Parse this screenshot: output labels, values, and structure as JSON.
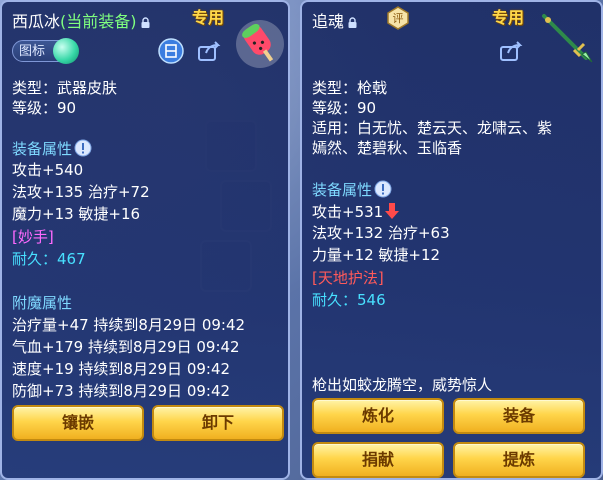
{
  "left": {
    "name": "西瓜冰",
    "equipped_note": "(当前装备)",
    "exclusive": "专用",
    "tag_label": "图标",
    "type": "类型：武器皮肤",
    "level": "等级：90",
    "attr_title": "装备属性",
    "attr_lines": [
      "攻击+540",
      "法攻+135 治疗+72",
      "魔力+13 敏捷+16"
    ],
    "special": "[妙手]",
    "durability_label": "耐久：",
    "durability_value": "467",
    "enchant_title": "附魔属性",
    "enchant_lines": [
      "治疗量+47 持续到8月29日 09:42",
      "气血+179 持续到8月29日 09:42",
      "速度+19 持续到8月29日 09:42",
      "防御+73 持续到8月29日 09:42"
    ],
    "buttons": [
      "镶嵌",
      "卸下"
    ]
  },
  "right": {
    "name": "追魂",
    "exclusive": "专用",
    "badge": "评",
    "type": "类型：枪戟",
    "level": "等级：90",
    "suit_line1": "适用：白无忧、楚云天、龙啸云、紫",
    "suit_line2": "嫣然、楚碧秋、玉临香",
    "attr_title": "装备属性",
    "attr_lines": [
      "攻击+531",
      "法攻+132 治疗+63",
      "力量+12 敏捷+12"
    ],
    "special": "[天地护法]",
    "durability_label": "耐久：",
    "durability_value": "546",
    "description": "枪出如蛟龙腾空，威势惊人",
    "buttons": [
      "炼化",
      "装备",
      "捐献",
      "提炼"
    ]
  },
  "icons": {
    "lock": "lock-icon",
    "share": "share-icon",
    "compare": "compare-icon",
    "info": "info-icon",
    "down_arrow": "arrow-down-icon"
  },
  "colors": {
    "highlight_green": "#7fff7f",
    "section_blue": "#7fd9ff",
    "special_pink": "#ff6aff",
    "special_red": "#ff5a5a",
    "durability_cyan": "#48e0ff",
    "button_gold": "#ffd54a"
  }
}
